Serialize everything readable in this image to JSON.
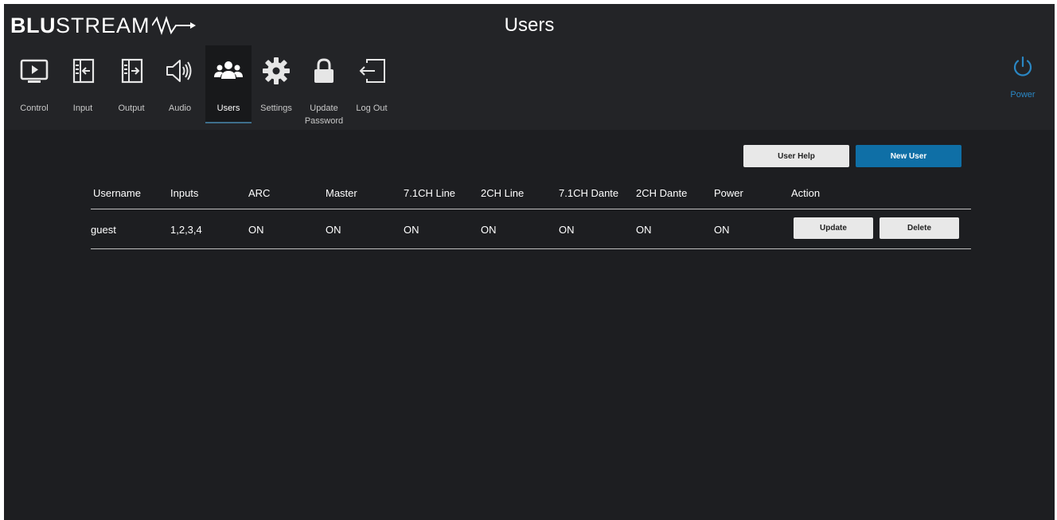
{
  "brand": {
    "bold": "BLU",
    "light": "STREAM"
  },
  "header": {
    "title": "Users"
  },
  "nav": [
    {
      "label": "Control",
      "icon": "play-screen-icon"
    },
    {
      "label": "Input",
      "icon": "input-icon"
    },
    {
      "label": "Output",
      "icon": "output-icon"
    },
    {
      "label": "Audio",
      "icon": "speaker-icon"
    },
    {
      "label": "Users",
      "icon": "users-icon",
      "active": true
    },
    {
      "label": "Settings",
      "icon": "gear-icon"
    },
    {
      "label": "Update Password",
      "icon": "lock-icon"
    },
    {
      "label": "Log Out",
      "icon": "logout-icon"
    }
  ],
  "power": {
    "label": "Power",
    "icon": "power-icon"
  },
  "actions": {
    "user_help": "User Help",
    "new_user": "New User"
  },
  "table": {
    "columns": [
      "Username",
      "Inputs",
      "ARC",
      "Master",
      "7.1CH Line",
      "2CH Line",
      "7.1CH Dante",
      "2CH Dante",
      "Power",
      "Action"
    ],
    "rows": [
      {
        "cells": [
          "guest",
          "1,2,3,4",
          "ON",
          "ON",
          "ON",
          "ON",
          "ON",
          "ON",
          "ON"
        ],
        "update": "Update",
        "delete": "Delete"
      }
    ]
  },
  "colors": {
    "accent": "#0f6fa6",
    "power": "#2a87c4",
    "background": "#1d1e21",
    "header": "#232427"
  }
}
